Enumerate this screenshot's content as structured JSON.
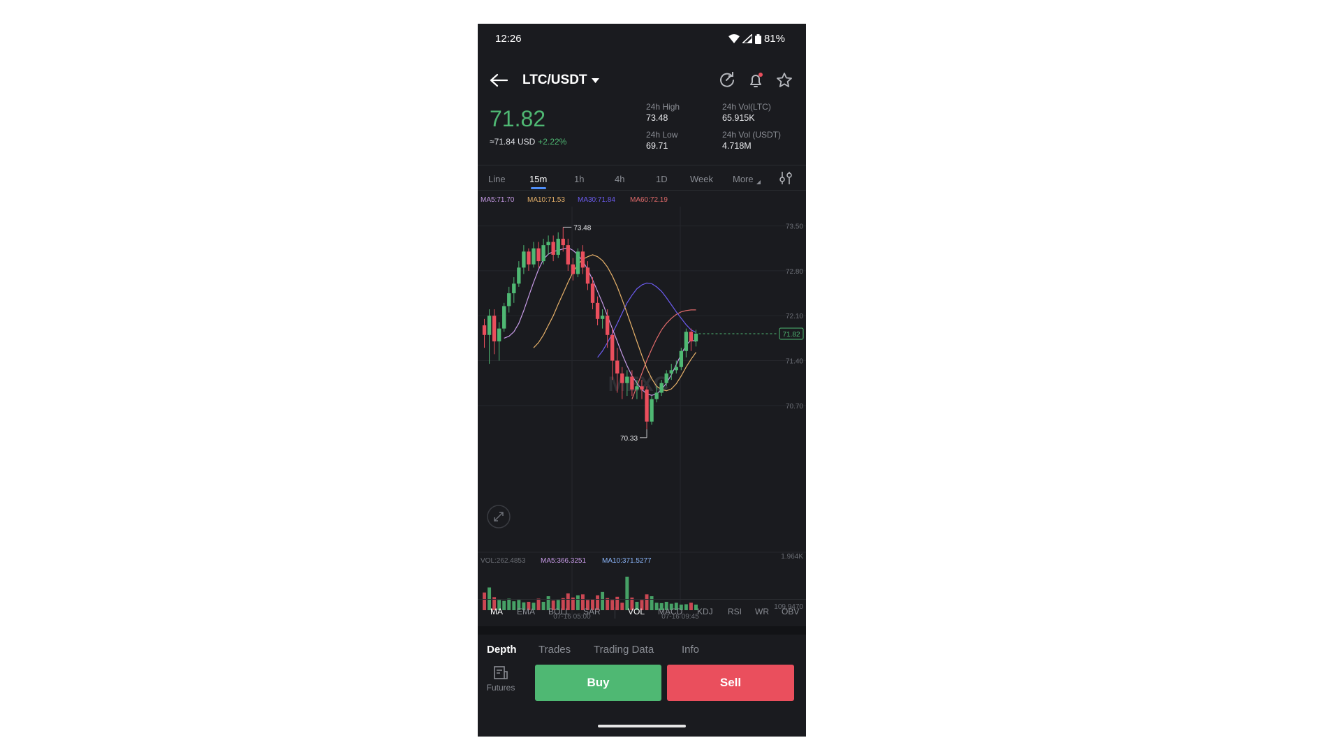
{
  "status_bar": {
    "time": "12:26",
    "battery": "81%"
  },
  "header": {
    "pair": "LTC/USDT"
  },
  "ticker": {
    "price": "71.82",
    "usd": "≈71.84 USD",
    "change": "+2.22%",
    "high_label": "24h High",
    "high": "73.48",
    "low_label": "24h Low",
    "low": "69.71",
    "vol_ltc_label": "24h Vol(LTC)",
    "vol_ltc": "65.915K",
    "vol_usdt_label": "24h Vol (USDT)",
    "vol_usdt": "4.718M"
  },
  "timeframes": [
    "Line",
    "15m",
    "1h",
    "4h",
    "1D",
    "Week",
    "More"
  ],
  "active_timeframe": "15m",
  "ma_legend": {
    "ma5": "MA5:71.70",
    "ma10": "MA10:71.53",
    "ma30": "MA30:71.84",
    "ma60": "MA60:72.19"
  },
  "vol_legend": {
    "vol": "VOL:262.4853",
    "ma5": "MA5:366.3251",
    "ma10": "MA10:371.5277"
  },
  "watermark": "MEXC",
  "colors": {
    "up": "#4fb873",
    "down": "#ea4f5d",
    "ma5": "#c79be7",
    "ma10": "#e8b26a",
    "ma30": "#6c5cf0",
    "ma60": "#e06a6a",
    "accent": "#4f8ef7"
  },
  "indicators_main": [
    "MA",
    "EMA",
    "BOLL",
    "SAR"
  ],
  "indicators_sub": [
    "VOL",
    "MACD",
    "KDJ",
    "RSI",
    "WR",
    "OBV"
  ],
  "bottom_tabs": [
    "Depth",
    "Trades",
    "Trading Data",
    "Info"
  ],
  "actions": {
    "futures": "Futures",
    "buy": "Buy",
    "sell": "Sell"
  },
  "chart_data": {
    "type": "candlestick",
    "y_ticks": [
      "73.50",
      "72.80",
      "72.10",
      "71.40",
      "70.70"
    ],
    "ylim": [
      70.1,
      73.8
    ],
    "vol_ticks": [
      "1.964K",
      "109.9470"
    ],
    "x_ticks": [
      "07-16 05:00",
      "07-16 09:45"
    ],
    "high_marker": "73.48",
    "low_marker": "70.33",
    "last_price": "71.82",
    "candles": [
      [
        71.95,
        71.8,
        72.05,
        71.6
      ],
      [
        71.8,
        72.1,
        72.2,
        71.35
      ],
      [
        72.1,
        71.7,
        72.2,
        71.5
      ],
      [
        71.7,
        71.9,
        72.0,
        71.4
      ],
      [
        71.9,
        72.25,
        72.3,
        71.85
      ],
      [
        72.25,
        72.45,
        72.55,
        72.15
      ],
      [
        72.45,
        72.6,
        72.7,
        72.3
      ],
      [
        72.6,
        72.85,
        72.95,
        72.55
      ],
      [
        72.85,
        73.1,
        73.2,
        72.75
      ],
      [
        73.1,
        72.9,
        73.15,
        72.8
      ],
      [
        72.9,
        73.15,
        73.25,
        72.85
      ],
      [
        73.15,
        72.95,
        73.25,
        72.85
      ],
      [
        72.95,
        73.2,
        73.3,
        72.9
      ],
      [
        73.2,
        73.25,
        73.35,
        73.05
      ],
      [
        73.25,
        73.05,
        73.35,
        72.95
      ],
      [
        73.05,
        73.3,
        73.4,
        73.0
      ],
      [
        73.3,
        73.2,
        73.48,
        73.1
      ],
      [
        73.2,
        72.9,
        73.3,
        72.8
      ],
      [
        72.9,
        72.75,
        73.0,
        72.65
      ],
      [
        72.75,
        73.1,
        73.15,
        72.7
      ],
      [
        73.1,
        72.85,
        73.2,
        72.75
      ],
      [
        72.85,
        72.6,
        72.95,
        72.5
      ],
      [
        72.6,
        72.3,
        72.7,
        72.2
      ],
      [
        72.3,
        72.05,
        72.4,
        71.95
      ],
      [
        72.05,
        72.1,
        72.2,
        71.9
      ],
      [
        72.1,
        71.8,
        72.2,
        71.6
      ],
      [
        71.8,
        71.4,
        71.9,
        71.1
      ],
      [
        71.4,
        71.2,
        71.6,
        70.9
      ],
      [
        71.2,
        71.05,
        71.3,
        70.8
      ],
      [
        71.05,
        71.15,
        71.25,
        70.85
      ],
      [
        71.15,
        70.95,
        71.25,
        70.85
      ],
      [
        70.95,
        71.0,
        71.1,
        70.8
      ],
      [
        71.0,
        70.95,
        71.1,
        70.8
      ],
      [
        70.95,
        70.45,
        71.0,
        70.33
      ],
      [
        70.45,
        70.8,
        70.85,
        70.4
      ],
      [
        70.8,
        70.9,
        71.0,
        70.75
      ],
      [
        70.9,
        71.05,
        71.1,
        70.85
      ],
      [
        71.05,
        71.2,
        71.25,
        71.0
      ],
      [
        71.2,
        71.25,
        71.35,
        71.1
      ],
      [
        71.25,
        71.3,
        71.4,
        71.2
      ],
      [
        71.3,
        71.55,
        71.6,
        71.25
      ],
      [
        71.55,
        71.85,
        71.9,
        71.45
      ],
      [
        71.85,
        71.7,
        71.9,
        71.55
      ],
      [
        71.7,
        71.82,
        71.88,
        71.62
      ]
    ],
    "volumes": [
      0.95,
      1.22,
      0.7,
      0.55,
      0.5,
      0.62,
      0.48,
      0.55,
      0.42,
      0.45,
      0.4,
      0.62,
      0.45,
      0.75,
      0.52,
      0.55,
      0.65,
      0.9,
      0.68,
      0.8,
      0.85,
      0.55,
      0.6,
      0.8,
      0.98,
      0.65,
      0.55,
      0.72,
      0.4,
      1.8,
      0.68,
      0.45,
      0.55,
      0.85,
      0.75,
      0.4,
      0.38,
      0.45,
      0.35,
      0.4,
      0.3,
      0.32,
      0.4,
      0.3
    ],
    "ma5": [
      71.75,
      71.78,
      71.85,
      71.98,
      72.18,
      72.4,
      72.62,
      72.82,
      72.98,
      73.06,
      73.1,
      73.12,
      73.14,
      73.16,
      73.12,
      73.05,
      72.95,
      72.82,
      72.66,
      72.48,
      72.3,
      72.1,
      71.9,
      71.7,
      71.5,
      71.32,
      71.16,
      71.05,
      70.95,
      70.88,
      70.86,
      70.88,
      70.95,
      71.05,
      71.18,
      71.34,
      71.5,
      71.64,
      71.72,
      71.7
    ],
    "ma10": [
      71.6,
      71.68,
      71.8,
      71.95,
      72.1,
      72.28,
      72.45,
      72.62,
      72.78,
      72.9,
      72.98,
      73.02,
      73.05,
      73.02,
      72.96,
      72.86,
      72.72,
      72.55,
      72.35,
      72.14,
      71.92,
      71.7,
      71.48,
      71.28,
      71.12,
      71.0,
      70.95,
      70.93,
      70.96,
      71.04,
      71.16,
      71.3,
      71.42,
      71.53
    ],
    "ma30": [
      71.45,
      71.55,
      71.68,
      71.82,
      71.98,
      72.14,
      72.3,
      72.42,
      72.52,
      72.58,
      72.61,
      72.6,
      72.55,
      72.48,
      72.38,
      72.27,
      72.16,
      72.06,
      71.96,
      71.88,
      71.84
    ],
    "ma60": [
      70.8,
      71.0,
      71.2,
      71.4,
      71.58,
      71.74,
      71.88,
      71.98,
      72.06,
      72.12,
      72.16,
      72.18,
      72.19,
      72.19
    ]
  }
}
